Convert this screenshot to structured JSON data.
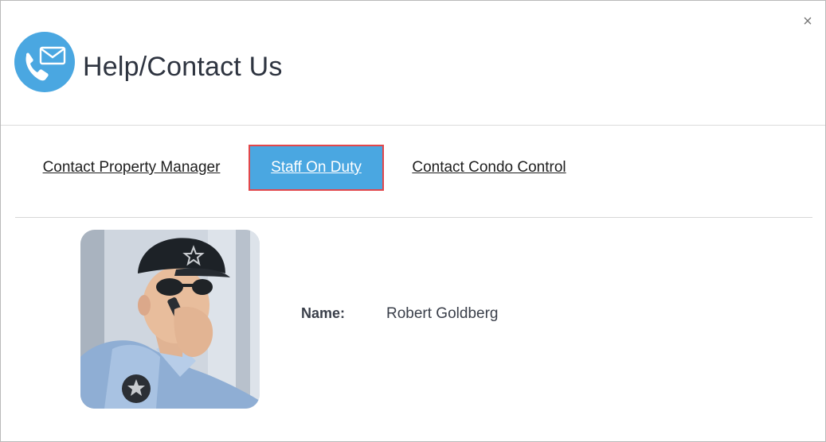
{
  "dialog": {
    "title": "Help/Contact Us",
    "close_label": "×"
  },
  "tabs": [
    {
      "label": "Contact Property Manager",
      "active": false
    },
    {
      "label": "Staff On Duty",
      "active": true
    },
    {
      "label": "Contact Condo Control",
      "active": false
    }
  ],
  "staff": {
    "name_label": "Name:",
    "name_value": "Robert Goldberg"
  },
  "colors": {
    "accent": "#4aa7e1",
    "active_tab_border": "#e2474b",
    "title_text": "#2e3440"
  },
  "icons": {
    "header": "phone-envelope-icon",
    "close": "close-icon"
  }
}
